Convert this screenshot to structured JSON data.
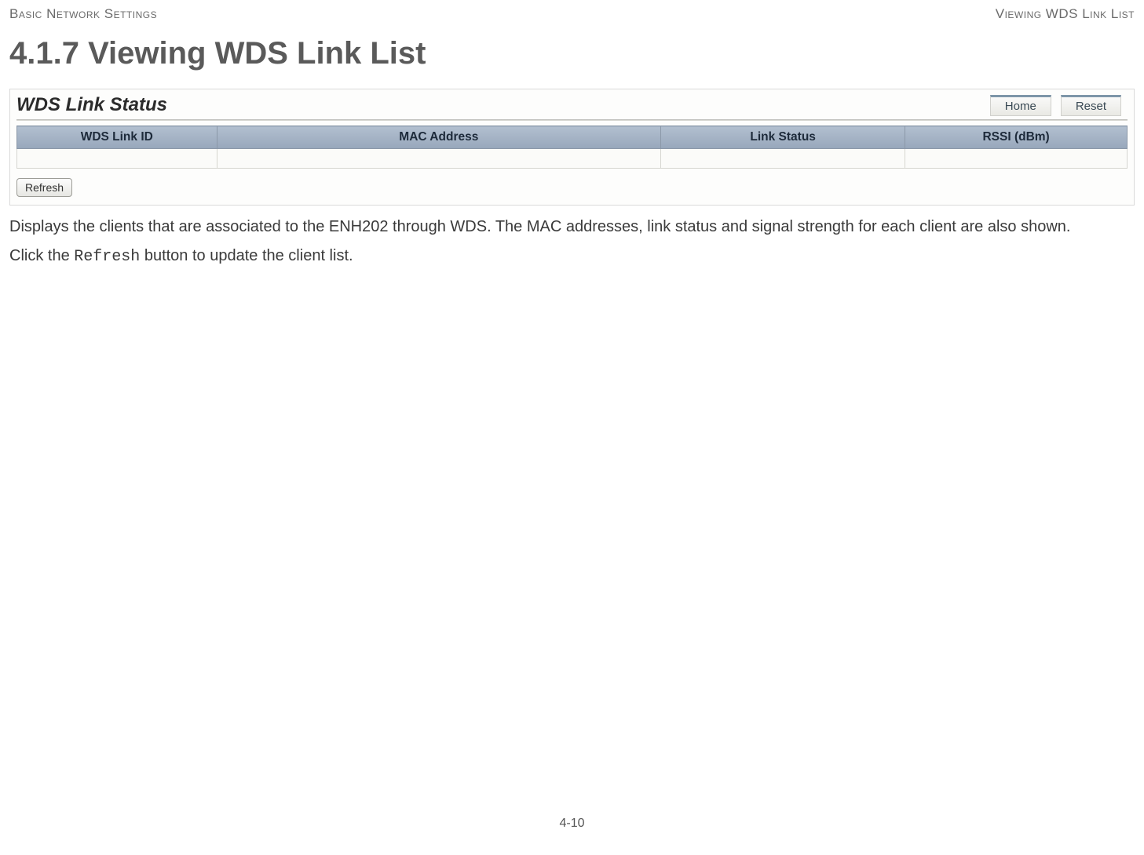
{
  "header": {
    "left": "Basic Network Settings",
    "right": "Viewing WDS Link List"
  },
  "heading": "4.1.7 Viewing WDS Link List",
  "panel": {
    "title": "WDS Link Status",
    "nav": {
      "home": "Home",
      "reset": "Reset"
    },
    "columns": {
      "c1": "WDS Link ID",
      "c2": "MAC Address",
      "c3": "Link Status",
      "c4": "RSSI (dBm)"
    },
    "refresh": "Refresh"
  },
  "paragraph1": "Displays the clients that are associated to the ENH202 through WDS. The MAC addresses, link status and signal strength for each client are also shown.",
  "paragraph2_pre": "Click the ",
  "paragraph2_code": "Refresh",
  "paragraph2_post": " button to update the client list.",
  "page_number": "4-10"
}
